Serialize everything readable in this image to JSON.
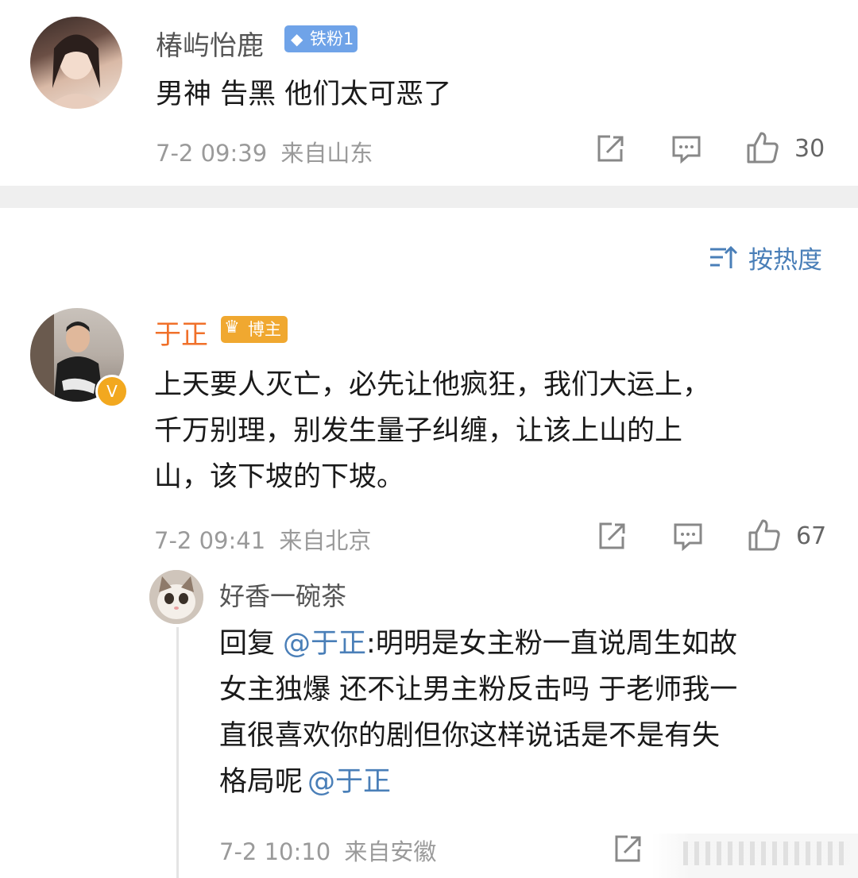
{
  "comment1": {
    "username": "椿屿怡鹿",
    "badge": "铁粉1",
    "text": "男神 告黑 他们太可恶了",
    "time": "7-2 09:39",
    "location": "来自山东",
    "likes": "30"
  },
  "sort": {
    "label": "按热度"
  },
  "comment2": {
    "username": "于正",
    "badge": "博主",
    "lines": [
      "上天要人灭亡，必先让他疯狂，我们大运上，",
      "千万别理，别发生量子纠缠，让该上山的上",
      "山，该下坡的下坡。"
    ],
    "time": "7-2 09:41",
    "location": "来自北京",
    "likes": "67"
  },
  "reply": {
    "username": "好香一碗茶",
    "prefix": "回复",
    "mention": "@于正",
    "line1_rest": ":明明是女主粉一直说周生如故",
    "line2": "女主独爆 还不让男主粉反击吗 于老师我一",
    "line3": "直很喜欢你的剧但你这样说话是不是有失",
    "line4_text": "格局呢",
    "line4_mention": "@于正",
    "time": "7-2 10:10",
    "location": "来自安徽"
  },
  "colors": {
    "accent_orange": "#f0702a",
    "mention_blue": "#4a7fb8",
    "badge_blue": "#6fa3e8",
    "badge_gold": "#f0a830"
  }
}
